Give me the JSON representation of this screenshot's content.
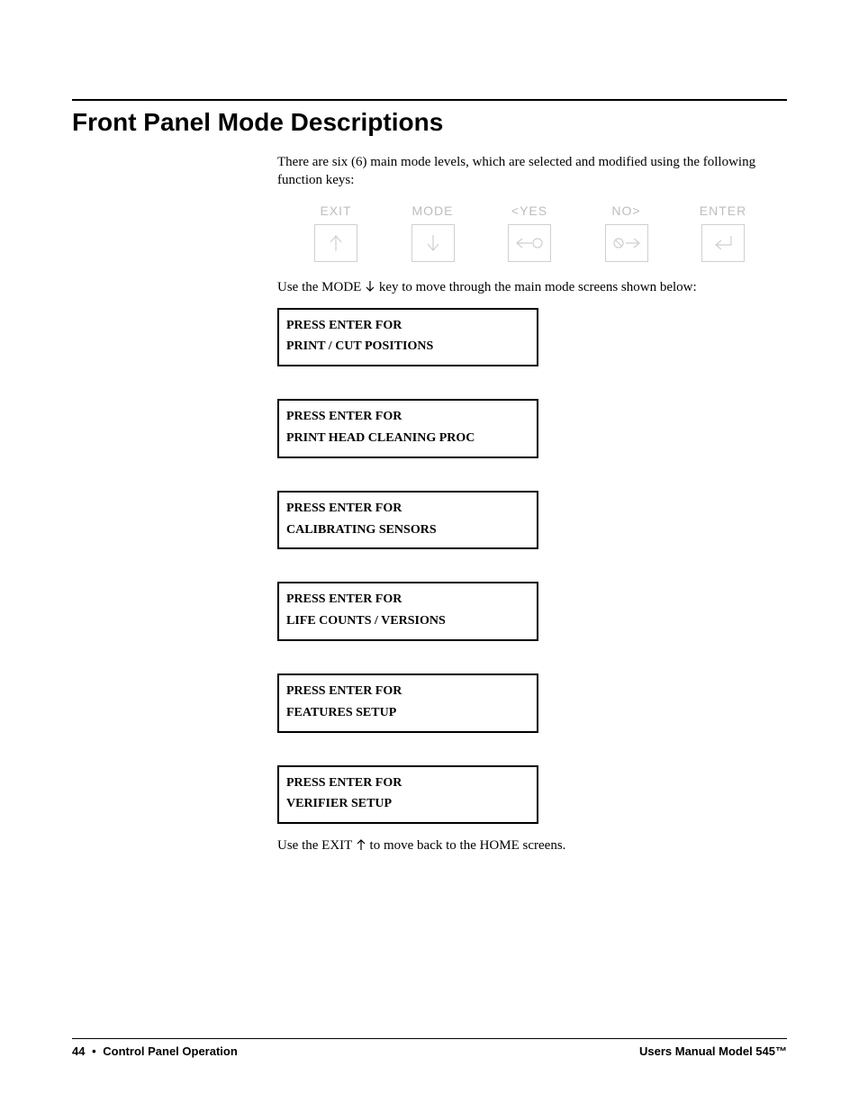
{
  "heading": "Front Panel Mode Descriptions",
  "intro": "There are six (6) main mode levels, which are selected and modified using the following function keys:",
  "keys": {
    "exit": "EXIT",
    "mode": "MODE",
    "yes": "<YES",
    "no": "NO>",
    "enter": "ENTER"
  },
  "sentence_mode_pre": "Use the MODE ",
  "sentence_mode_post": " key to move through the main mode screens shown below:",
  "mode_boxes": [
    {
      "line1": "PRESS ENTER FOR",
      "line2": "PRINT / CUT POSITIONS"
    },
    {
      "line1": "PRESS ENTER FOR",
      "line2": "PRINT HEAD CLEANING PROC"
    },
    {
      "line1": "PRESS ENTER FOR",
      "line2": "CALIBRATING SENSORS"
    },
    {
      "line1": "PRESS ENTER FOR",
      "line2": "LIFE COUNTS / VERSIONS"
    },
    {
      "line1": "PRESS ENTER FOR",
      "line2": "FEATURES SETUP"
    },
    {
      "line1": "PRESS ENTER FOR",
      "line2": "VERIFIER SETUP"
    }
  ],
  "sentence_exit_pre": "Use the EXIT ",
  "sentence_exit_post": " to move back to the HOME screens.",
  "footer": {
    "page_number": "44",
    "bullet": "•",
    "section": "Control Panel Operation",
    "right": "Users Manual Model 545™"
  }
}
